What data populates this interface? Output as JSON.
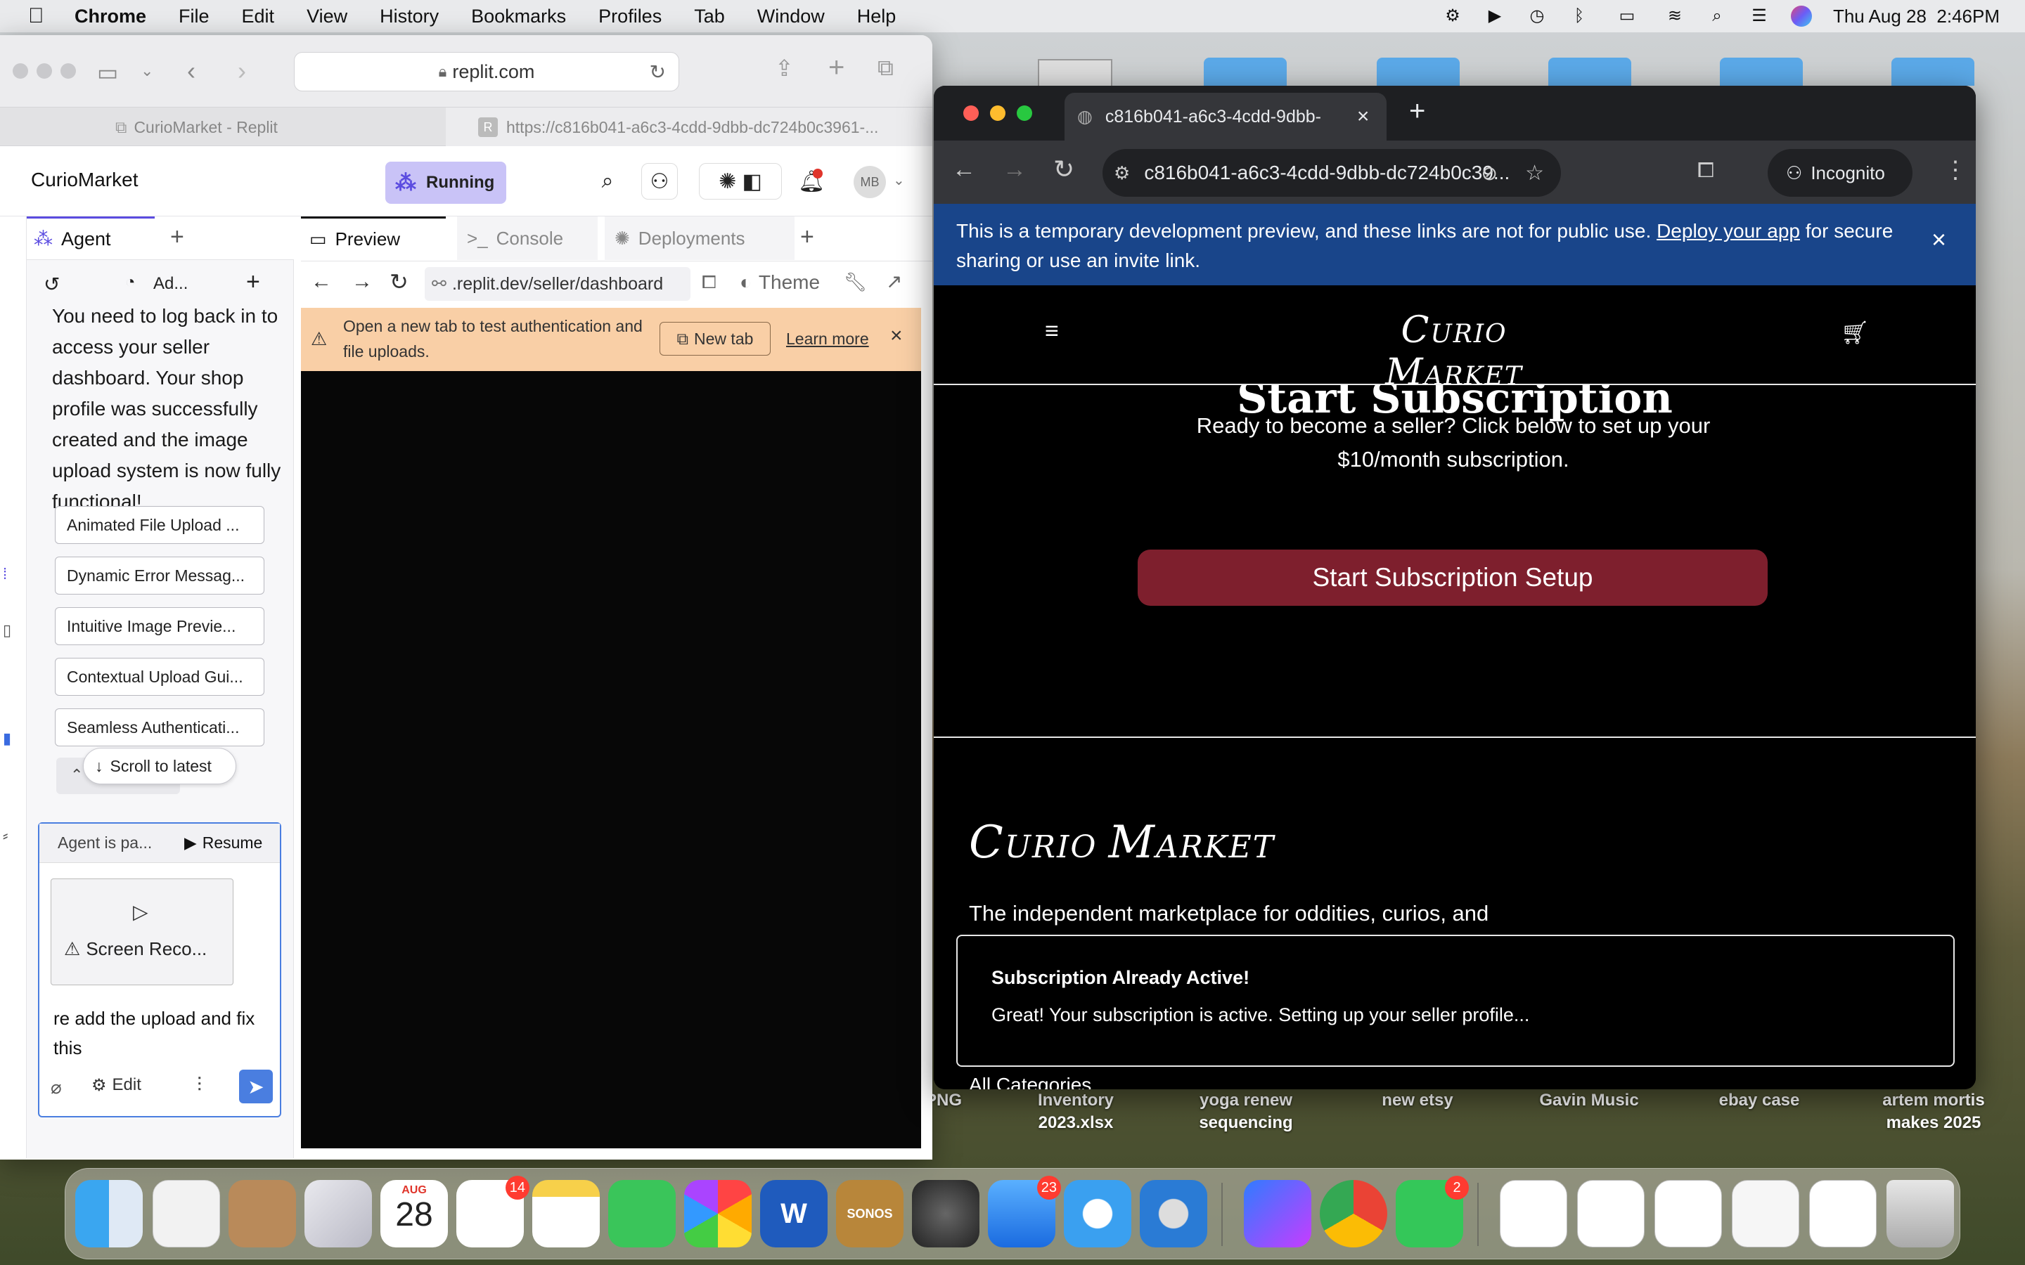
{
  "menubar": {
    "app": "Chrome",
    "items": [
      "File",
      "Edit",
      "View",
      "History",
      "Bookmarks",
      "Profiles",
      "Tab",
      "Window",
      "Help"
    ],
    "clock": "Thu Aug 28  2:46PM"
  },
  "desktop": {
    "items": [
      {
        "label": "PNG"
      },
      {
        "label": "Inventory 2023.xlsx"
      },
      {
        "label": "yoga renew sequencing"
      },
      {
        "label": "new etsy"
      },
      {
        "label": "Gavin Music"
      },
      {
        "label": "ebay case"
      },
      {
        "label": "artem mortis makes 2025"
      }
    ]
  },
  "safari": {
    "url": "replit.com",
    "tabs": [
      "CurioMarket - Replit",
      "https://c816b041-a6c3-4cdd-9dbb-dc724b0c3961-..."
    ]
  },
  "replit": {
    "project": "CurioMarket",
    "status": "Running",
    "avatar": "MB",
    "agent": {
      "tab": "Agent",
      "toolbar_label": "Ad...",
      "message": "You need to log back in to access your seller dashboard. Your shop profile was successfully created and the image upload system is now fully functional!",
      "suggestions": [
        "Animated File Upload ...",
        "Dynamic Error Messag...",
        "Intuitive Image Previe...",
        "Contextual Upload Gui...",
        "Seamless Authenticati..."
      ],
      "scroll_label": "Scroll to latest",
      "paused_label": "Agent is pa...",
      "resume_label": "Resume",
      "attachment_label": "Screen Reco...",
      "input_text": "re add the upload and fix this",
      "edit_label": "Edit"
    },
    "preview": {
      "tabs": [
        "Preview",
        "Console",
        "Deployments"
      ],
      "path": ".replit.dev/seller/dashboard",
      "theme_label": "Theme",
      "warning": "Open a new tab to test authentication and file uploads.",
      "new_tab_label": "New tab",
      "learn_more": "Learn more"
    }
  },
  "chrome": {
    "tab_title": "c816b041-a6c3-4cdd-9dbb-",
    "url": "c816b041-a6c3-4cdd-9dbb-dc724b0c39...",
    "incognito": "Incognito",
    "banner_text": "This is a temporary development preview, and these links are not for public use.",
    "banner_link": "Deploy your app",
    "banner_tail": "for secure sharing or use an invite link."
  },
  "site": {
    "logo_c": "C",
    "logo_urio": "URIO",
    "logo_m": "M",
    "logo_arket": "ARKET",
    "heading_partial": "Start Subscription",
    "subtitle": "Ready to become a seller? Click below to set up your $10/month subscription.",
    "cta": "Start Subscription Setup",
    "tagline": "The independent marketplace for oddities, curios, and specimens. Built by collectors, for collectors.",
    "toast_title": "Subscription Already Active!",
    "toast_body": "Great! Your subscription is active. Setting up your seller profile...",
    "categories": "All Categories"
  },
  "dock": {
    "calendar_month": "AUG",
    "calendar_day": "28",
    "reminders_badge": "14",
    "mail_badge": "23",
    "facetime_badge": "2",
    "sonos_label": "SONOS",
    "word_label": "W"
  }
}
